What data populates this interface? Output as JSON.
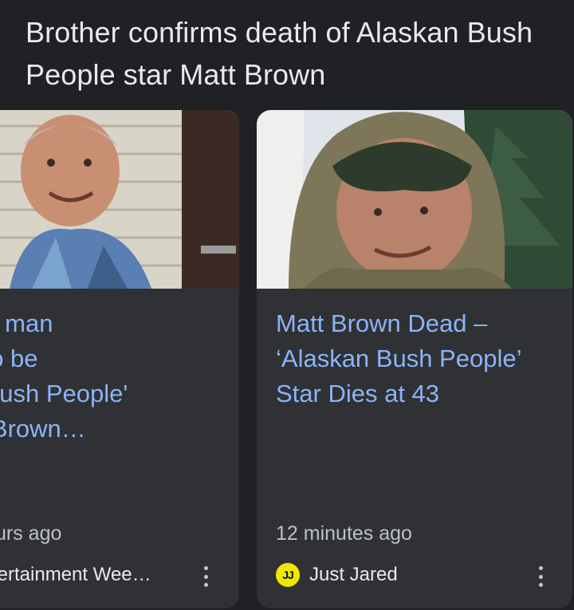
{
  "story": {
    "title": "Brother confirms death of Alaskan Bush People star Matt Brown"
  },
  "cards": [
    {
      "headline": "...ch for man\n...ved to be\n...kan Bush People'\n...Matt Brown…",
      "headline_lines": [
        "ch for man",
        "ved to be",
        "kan Bush People'",
        "Matt Brown…"
      ],
      "time_ago": "urs ago",
      "source": "tertainment Wee…",
      "image_icon": "photo-thumbnail"
    },
    {
      "headline_lines": [
        "Matt Brown Dead –",
        "‘Alaskan Bush People’",
        "Star Dies at 43"
      ],
      "time_ago": "12 minutes ago",
      "source": "Just Jared",
      "source_logo_text": "JJ",
      "image_icon": "photo-thumbnail"
    }
  ],
  "colors": {
    "background": "#202124",
    "card": "#303134",
    "headline": "#8ab4f8",
    "title": "#e8eaed",
    "muted": "#bdc1c6",
    "jj_logo": "#f1e600"
  },
  "icons": {
    "more": "three-dots-vertical-icon"
  }
}
